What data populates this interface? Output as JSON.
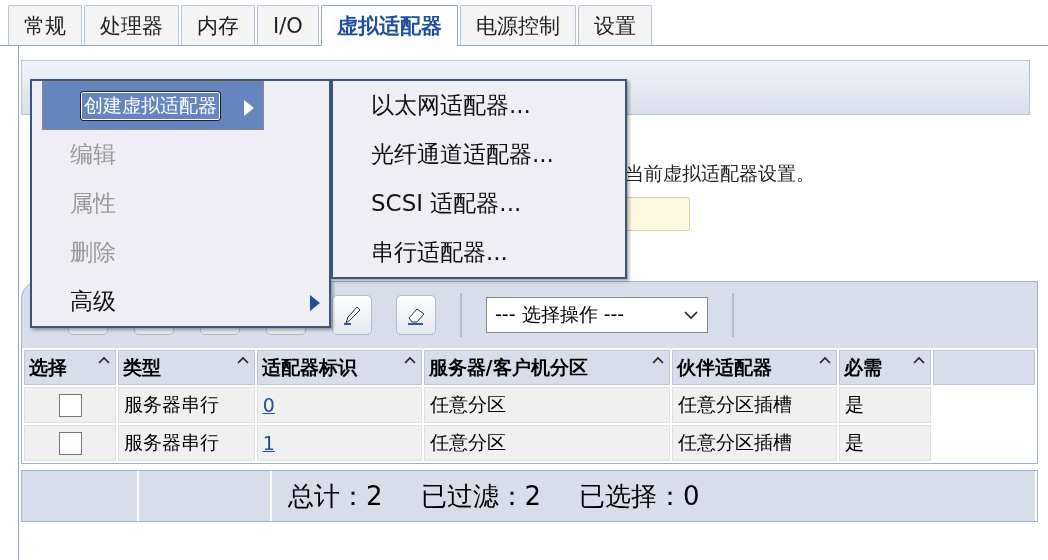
{
  "tabs": [
    {
      "label": "常规",
      "selected": false
    },
    {
      "label": "处理器",
      "selected": false
    },
    {
      "label": "内存",
      "selected": false
    },
    {
      "label": "I/O",
      "selected": false
    },
    {
      "label": "虚拟适配器",
      "selected": true
    },
    {
      "label": "电源控制",
      "selected": false
    },
    {
      "label": "设置",
      "selected": false
    }
  ],
  "description": "当前虚拟适配器设置。",
  "context_menu": {
    "items": [
      {
        "label": "创建虚拟适配器",
        "disabled": false,
        "selected": true,
        "submenu": true
      },
      {
        "label": "编辑",
        "disabled": true,
        "selected": false,
        "submenu": false
      },
      {
        "label": "属性",
        "disabled": true,
        "selected": false,
        "submenu": false
      },
      {
        "label": "删除",
        "disabled": true,
        "selected": false,
        "submenu": false
      },
      {
        "label": "高级",
        "disabled": false,
        "selected": false,
        "submenu": true
      }
    ]
  },
  "submenu": {
    "items": [
      "以太网适配器...",
      "光纤通道适配器...",
      "SCSI 适配器...",
      "串行适配器..."
    ]
  },
  "toolbar": {
    "action_select": "--- 选择操作 ---"
  },
  "table": {
    "columns": [
      "选择",
      "类型",
      "适配器标识",
      "服务器/客户机分区",
      "伙伴适配器",
      "必需"
    ],
    "rows": [
      {
        "checked": false,
        "cells": [
          "",
          "服务器串行",
          "0",
          "任意分区",
          "任意分区插槽",
          "是"
        ]
      },
      {
        "checked": false,
        "cells": [
          "",
          "服务器串行",
          "1",
          "任意分区",
          "任意分区插槽",
          "是"
        ]
      }
    ]
  },
  "footer": {
    "total": "总计：2",
    "filtered": "已过滤：2",
    "selected": "已选择：0"
  }
}
